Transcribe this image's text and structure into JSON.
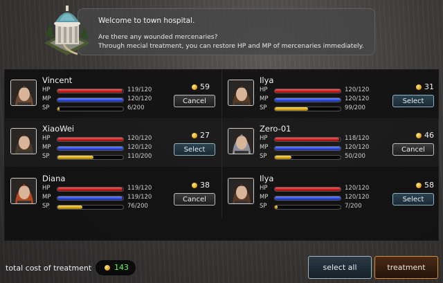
{
  "header": {
    "welcome": "Welcome to town hospital.",
    "line1": "Are there any wounded mercenaries?",
    "line2": "Through mecial treatment, you can restore HP and MP of mercenaries immediately."
  },
  "labels": {
    "hp": "HP",
    "mp": "MP",
    "sp": "SP"
  },
  "mercenaries": [
    {
      "name": "Vincent",
      "hp": "119/120",
      "hp_frac": 0.99,
      "mp": "120/120",
      "mp_frac": 1.0,
      "sp": "6/200",
      "sp_frac": 0.03,
      "cost": "59",
      "button": "Cancel",
      "state": "cancel",
      "portrait_color": "#6e4a32"
    },
    {
      "name": "Ilya",
      "hp": "120/120",
      "hp_frac": 1.0,
      "mp": "120/120",
      "mp_frac": 1.0,
      "sp": "99/200",
      "sp_frac": 0.5,
      "cost": "31",
      "button": "Select",
      "state": "select",
      "portrait_color": "#5a3a24"
    },
    {
      "name": "XiaoWei",
      "hp": "120/120",
      "hp_frac": 1.0,
      "mp": "120/120",
      "mp_frac": 1.0,
      "sp": "110/200",
      "sp_frac": 0.55,
      "cost": "27",
      "button": "Select",
      "state": "select",
      "portrait_color": "#4a3a2a"
    },
    {
      "name": "Zero-01",
      "hp": "118/120",
      "hp_frac": 0.98,
      "mp": "120/120",
      "mp_frac": 1.0,
      "sp": "50/200",
      "sp_frac": 0.25,
      "cost": "46",
      "button": "Cancel",
      "state": "cancel",
      "portrait_color": "#8a8f9a"
    },
    {
      "name": "Diana",
      "hp": "119/120",
      "hp_frac": 0.99,
      "mp": "119/120",
      "mp_frac": 0.99,
      "sp": "76/200",
      "sp_frac": 0.38,
      "cost": "38",
      "button": "Cancel",
      "state": "cancel",
      "portrait_color": "#b04a22"
    },
    {
      "name": "Ilya",
      "hp": "120/120",
      "hp_frac": 1.0,
      "mp": "120/120",
      "mp_frac": 1.0,
      "sp": "7/200",
      "sp_frac": 0.04,
      "cost": "58",
      "button": "Select",
      "state": "select",
      "portrait_color": "#5a3a24"
    }
  ],
  "footer": {
    "total_label": "total cost of treatment",
    "total_value": "143",
    "select_all": "select all",
    "treatment": "treatment"
  },
  "colors": {
    "hp": "#d42020",
    "mp": "#2c46e0",
    "sp": "#d6a616",
    "total_value": "#5cff58",
    "treatment_border": "#e08a3c",
    "select_border": "#8fb2c4"
  },
  "icons": {
    "coin": "coin-icon",
    "building": "hospital-building-icon"
  }
}
